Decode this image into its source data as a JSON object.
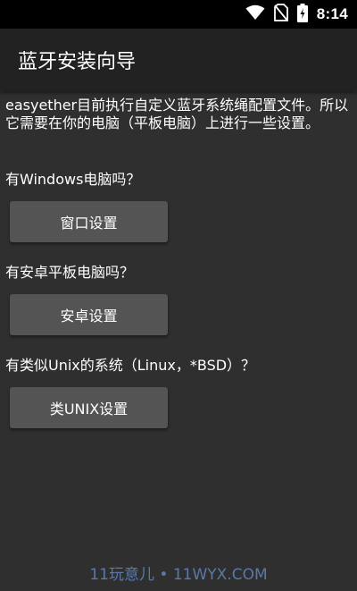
{
  "status_bar": {
    "time": "8:14",
    "icons": [
      "wifi-icon",
      "no-sim-icon",
      "battery-charging-icon"
    ]
  },
  "app_bar": {
    "title": "蓝牙安装向导"
  },
  "content": {
    "intro": "easyether目前执行自定义蓝牙系统绳配置文件。所以它需要在你的电脑（平板电脑）上进行一些设置。",
    "sections": [
      {
        "question": "有Windows电脑吗？",
        "button_label": "窗口设置"
      },
      {
        "question": "有安卓平板电脑吗？",
        "button_label": "安卓设置"
      },
      {
        "question": "有类似Unix的系统（Linux，*BSD）？",
        "button_label": "类UNIX设置"
      }
    ]
  },
  "watermark": "11玩意儿 • 11WYX.COM",
  "colors": {
    "background": "#2f2f2f",
    "app_bar": "#222222",
    "status_bar": "#000000",
    "button": "#545454",
    "watermark": "#5a79a8"
  }
}
